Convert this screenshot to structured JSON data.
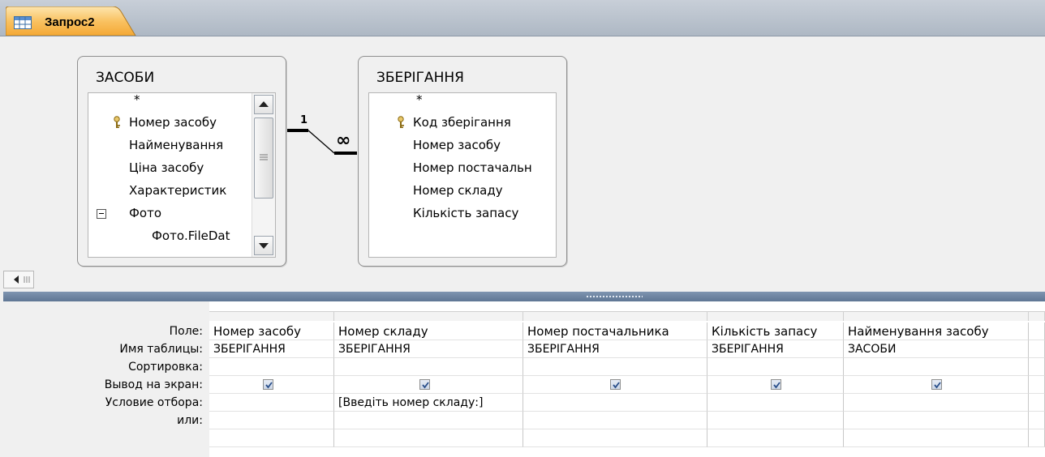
{
  "tab": {
    "title": "Запрос2",
    "icon": "query-grid-icon"
  },
  "tables": [
    {
      "title": "ЗАСОБИ",
      "fields": [
        "*",
        "Номер засобу",
        "Найменування",
        "Ціна засобу",
        "Характеристик",
        "Фото",
        "Фото.FileDat"
      ],
      "key_field_index": 1
    },
    {
      "title": "ЗБЕРІГАННЯ",
      "fields": [
        "*",
        "Код зберігання",
        "Номер засобу",
        "Номер постачальн",
        "Номер складу",
        "Кількість запасу"
      ],
      "key_field_index": 1
    }
  ],
  "relationship": {
    "one_label": "1",
    "many_label": "∞"
  },
  "grid": {
    "row_labels": [
      "Поле:",
      "Имя таблицы:",
      "Сортировка:",
      "Вывод на экран:",
      "Условие отбора:",
      "или:"
    ],
    "columns": [
      {
        "field": "Номер засобу",
        "table": "ЗБЕРІГАННЯ",
        "sort": "",
        "show": true,
        "criteria": "",
        "or": ""
      },
      {
        "field": "Номер складу",
        "table": "ЗБЕРІГАННЯ",
        "sort": "",
        "show": true,
        "criteria": "[Введіть номер складу:]",
        "or": ""
      },
      {
        "field": "Номер постачальника",
        "table": "ЗБЕРІГАННЯ",
        "sort": "",
        "show": true,
        "criteria": "",
        "or": ""
      },
      {
        "field": "Кількість запасу",
        "table": "ЗБЕРІГАННЯ",
        "sort": "",
        "show": true,
        "criteria": "",
        "or": ""
      },
      {
        "field": "Найменування засобу",
        "table": "ЗАСОБИ",
        "sort": "",
        "show": true,
        "criteria": "",
        "or": ""
      }
    ]
  },
  "colors": {
    "tab_accent": "#f5a623",
    "splitter": "#6f86a4"
  }
}
